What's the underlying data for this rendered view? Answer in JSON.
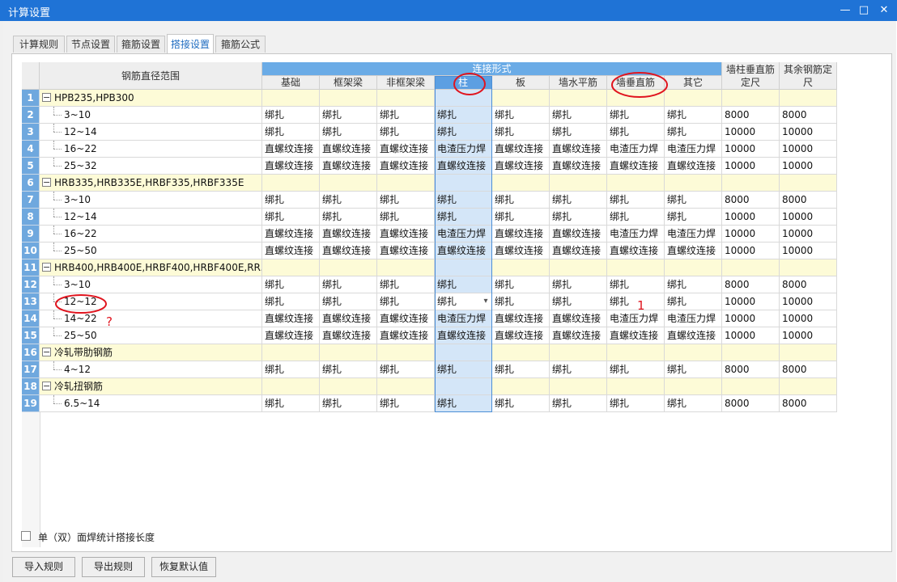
{
  "window": {
    "title": "计算设置",
    "minimize": "—",
    "maximize": "□",
    "close": "✕"
  },
  "tabs": [
    "计算规则",
    "节点设置",
    "箍筋设置",
    "搭接设置",
    "箍筋公式"
  ],
  "active_tab": 3,
  "table": {
    "range_header": "钢筋直径范围",
    "group_header": "连接形式",
    "columns": [
      "基础",
      "框架梁",
      "非框架梁",
      "柱",
      "板",
      "墙水平筋",
      "墙垂直筋",
      "其它"
    ],
    "col_wall_vertical_l1": "墙柱垂直筋",
    "col_wall_vertical_l2": "定尺",
    "col_other_l1": "其余钢筋定",
    "col_other_l2": "尺",
    "selected_column": 3,
    "rows": [
      {
        "num": "1",
        "group": true,
        "label": "HPB235,HPB300"
      },
      {
        "num": "2",
        "label": "3~10",
        "cells": [
          "绑扎",
          "绑扎",
          "绑扎",
          "绑扎",
          "绑扎",
          "绑扎",
          "绑扎",
          "绑扎",
          "8000",
          "8000"
        ]
      },
      {
        "num": "3",
        "label": "12~14",
        "cells": [
          "绑扎",
          "绑扎",
          "绑扎",
          "绑扎",
          "绑扎",
          "绑扎",
          "绑扎",
          "绑扎",
          "10000",
          "10000"
        ]
      },
      {
        "num": "4",
        "label": "16~22",
        "cells": [
          "直螺纹连接",
          "直螺纹连接",
          "直螺纹连接",
          "电渣压力焊",
          "直螺纹连接",
          "直螺纹连接",
          "电渣压力焊",
          "电渣压力焊",
          "10000",
          "10000"
        ]
      },
      {
        "num": "5",
        "label": "25~32",
        "cells": [
          "直螺纹连接",
          "直螺纹连接",
          "直螺纹连接",
          "直螺纹连接",
          "直螺纹连接",
          "直螺纹连接",
          "直螺纹连接",
          "直螺纹连接",
          "10000",
          "10000"
        ]
      },
      {
        "num": "6",
        "group": true,
        "label": "HRB335,HRB335E,HRBF335,HRBF335E"
      },
      {
        "num": "7",
        "label": "3~10",
        "cells": [
          "绑扎",
          "绑扎",
          "绑扎",
          "绑扎",
          "绑扎",
          "绑扎",
          "绑扎",
          "绑扎",
          "8000",
          "8000"
        ]
      },
      {
        "num": "8",
        "label": "12~14",
        "cells": [
          "绑扎",
          "绑扎",
          "绑扎",
          "绑扎",
          "绑扎",
          "绑扎",
          "绑扎",
          "绑扎",
          "10000",
          "10000"
        ]
      },
      {
        "num": "9",
        "label": "16~22",
        "cells": [
          "直螺纹连接",
          "直螺纹连接",
          "直螺纹连接",
          "电渣压力焊",
          "直螺纹连接",
          "直螺纹连接",
          "电渣压力焊",
          "电渣压力焊",
          "10000",
          "10000"
        ]
      },
      {
        "num": "10",
        "label": "25~50",
        "cells": [
          "直螺纹连接",
          "直螺纹连接",
          "直螺纹连接",
          "直螺纹连接",
          "直螺纹连接",
          "直螺纹连接",
          "直螺纹连接",
          "直螺纹连接",
          "10000",
          "10000"
        ]
      },
      {
        "num": "11",
        "group": true,
        "label": "HRB400,HRB400E,HRBF400,HRBF400E,RR..."
      },
      {
        "num": "12",
        "label": "3~10",
        "cells": [
          "绑扎",
          "绑扎",
          "绑扎",
          "绑扎",
          "绑扎",
          "绑扎",
          "绑扎",
          "绑扎",
          "8000",
          "8000"
        ]
      },
      {
        "num": "13",
        "label": "12~12",
        "dropdown_col": 3,
        "cells": [
          "绑扎",
          "绑扎",
          "绑扎",
          "绑扎",
          "绑扎",
          "绑扎",
          "绑扎",
          "绑扎",
          "10000",
          "10000"
        ]
      },
      {
        "num": "14",
        "label": "14~22",
        "cells": [
          "直螺纹连接",
          "直螺纹连接",
          "直螺纹连接",
          "电渣压力焊",
          "直螺纹连接",
          "直螺纹连接",
          "电渣压力焊",
          "电渣压力焊",
          "10000",
          "10000"
        ]
      },
      {
        "num": "15",
        "label": "25~50",
        "cells": [
          "直螺纹连接",
          "直螺纹连接",
          "直螺纹连接",
          "直螺纹连接",
          "直螺纹连接",
          "直螺纹连接",
          "直螺纹连接",
          "直螺纹连接",
          "10000",
          "10000"
        ]
      },
      {
        "num": "16",
        "group": true,
        "label": "冷轧带肋钢筋"
      },
      {
        "num": "17",
        "label": "4~12",
        "cells": [
          "绑扎",
          "绑扎",
          "绑扎",
          "绑扎",
          "绑扎",
          "绑扎",
          "绑扎",
          "绑扎",
          "8000",
          "8000"
        ]
      },
      {
        "num": "18",
        "group": true,
        "label": "冷轧扭钢筋"
      },
      {
        "num": "19",
        "label": "6.5~14",
        "cells": [
          "绑扎",
          "绑扎",
          "绑扎",
          "绑扎",
          "绑扎",
          "绑扎",
          "绑扎",
          "绑扎",
          "8000",
          "8000"
        ]
      }
    ]
  },
  "checkbox": {
    "label": "单（双）面焊统计搭接长度",
    "checked": false
  },
  "buttons": {
    "import": "导入规则",
    "export": "导出规则",
    "restore": "恢复默认值"
  },
  "annotations": {
    "mark_question": "?",
    "mark_one": "1",
    "color": "#e0141e"
  },
  "colors": {
    "titlebar": "#1f73d6",
    "header_blue": "#6aabe6",
    "group_row": "#fdfbd7",
    "selected_col": "#d4e6f8",
    "rownum": "#6fa8de"
  }
}
